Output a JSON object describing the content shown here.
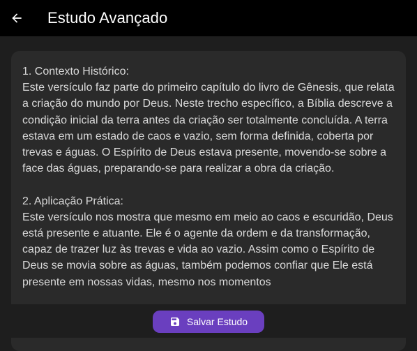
{
  "appbar": {
    "title": "Estudo Avançado",
    "back_icon": "arrow-left-icon"
  },
  "study": {
    "text": "1. Contexto Histórico:\nEste versículo faz parte do primeiro capítulo do livro de Gênesis, que relata a criação do mundo por Deus. Neste trecho específico, a Bíblia descreve a condição inicial da terra antes da criação ser totalmente concluída. A terra estava em um estado de caos e vazio, sem forma definida, coberta por trevas e águas. O Espírito de Deus estava presente, movendo-se sobre a face das águas, preparando-se para realizar a obra da criação.\n\n2. Aplicação Prática:\nEste versículo nos mostra que mesmo em meio ao caos e escuridão, Deus está presente e atuante. Ele é o agente da ordem e da transformação, capaz de trazer luz às trevas e vida ao vazio. Assim como o Espírito de Deus se movia sobre as águas, também podemos confiar que Ele está presente em nossas vidas, mesmo nos momentos"
  },
  "actions": {
    "save_label": "Salvar Estudo",
    "save_icon": "save-icon"
  },
  "colors": {
    "appbar_bg": "#000000",
    "background": "#1e1e1e",
    "card_bg": "#2a2a2a",
    "accent": "#6a3fbf"
  }
}
